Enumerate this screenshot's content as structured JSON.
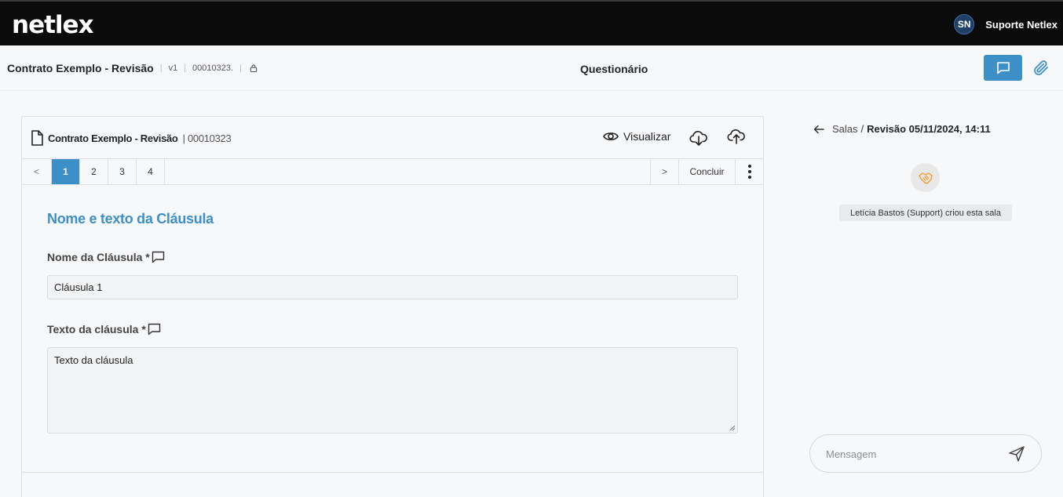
{
  "nav": {
    "logo": "netlex",
    "user_initials": "SN",
    "user_name": "Suporte Netlex"
  },
  "doc_header": {
    "title": "Contrato Exemplo - Revisão",
    "version": "v1",
    "code": "00010323.",
    "center_title": "Questionário"
  },
  "panel": {
    "title": "Contrato Exemplo - Revisão",
    "code": "| 00010323",
    "view_label": "Visualizar",
    "pager": {
      "prev": "<",
      "pages": [
        "1",
        "2",
        "3",
        "4"
      ],
      "active_page": "1",
      "next": ">",
      "conclude": "Concluir"
    },
    "section_title": "Nome e texto da Cláusula",
    "fields": {
      "name_label": "Nome da Cláusula *",
      "name_value": "Cláusula 1",
      "text_label": "Texto da cláusula *",
      "text_value": "Texto da cláusula"
    }
  },
  "chat": {
    "breadcrumb_rooms": "Salas",
    "breadcrumb_separator": "/",
    "breadcrumb_room": "Revisão 05/11/2024, 14:11",
    "system_message": "Letícia Bastos (Support) criou esta sala",
    "message_placeholder": "Mensagem"
  },
  "colors": {
    "accent": "#3d8fc7",
    "topbar": "#0b0b0c",
    "handshake": "#f0a23a"
  },
  "icons": [
    "file-icon",
    "eye-icon",
    "download-icon",
    "upload-icon",
    "chat-icon",
    "paperclip-icon",
    "lock-icon",
    "comment-icon",
    "arrow-left-icon",
    "handshake-icon",
    "send-icon",
    "more-vertical-icon"
  ]
}
